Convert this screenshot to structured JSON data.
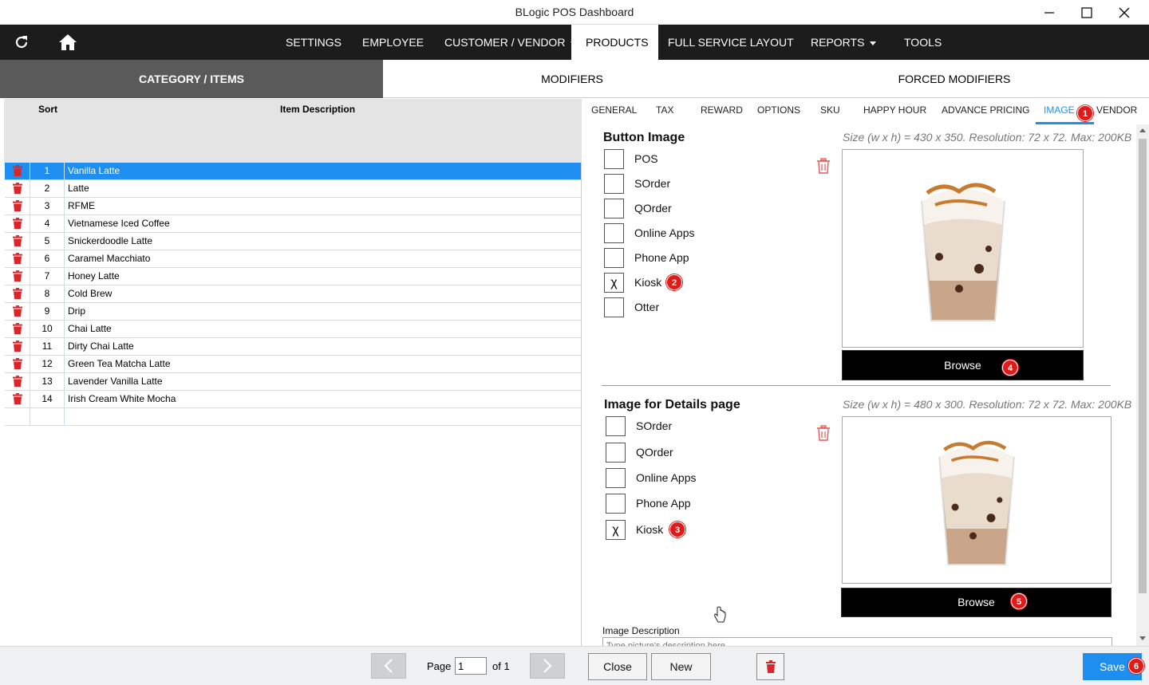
{
  "window": {
    "title": "BLogic POS Dashboard"
  },
  "nav": {
    "icons": [
      "refresh-icon",
      "home-icon"
    ],
    "items": [
      {
        "label": "SETTINGS"
      },
      {
        "label": "EMPLOYEE"
      },
      {
        "label": "CUSTOMER / VENDOR",
        "dropdown": true
      },
      {
        "label": "PRODUCTS",
        "active": true
      },
      {
        "label": "FULL SERVICE LAYOUT"
      },
      {
        "label": "REPORTS",
        "dropdown": true
      },
      {
        "label": "TOOLS"
      }
    ]
  },
  "section_tabs": [
    {
      "label": "CATEGORY / ITEMS",
      "active": true
    },
    {
      "label": "MODIFIERS"
    },
    {
      "label": "FORCED MODIFIERS"
    }
  ],
  "grid": {
    "columns": {
      "sort": "Sort",
      "description": "Item Description"
    },
    "rows": [
      {
        "sort": "1",
        "desc": "Vanilla Latte",
        "selected": true
      },
      {
        "sort": "2",
        "desc": "Latte"
      },
      {
        "sort": "3",
        "desc": "RFME"
      },
      {
        "sort": "4",
        "desc": "Vietnamese Iced Coffee"
      },
      {
        "sort": "5",
        "desc": "Snickerdoodle Latte"
      },
      {
        "sort": "6",
        "desc": "Caramel Macchiato"
      },
      {
        "sort": "7",
        "desc": "Honey Latte"
      },
      {
        "sort": "8",
        "desc": "Cold Brew"
      },
      {
        "sort": "9",
        "desc": "Drip"
      },
      {
        "sort": "10",
        "desc": "Chai Latte"
      },
      {
        "sort": "11",
        "desc": "Dirty Chai Latte"
      },
      {
        "sort": "12",
        "desc": "Green Tea Matcha Latte"
      },
      {
        "sort": "13",
        "desc": "Lavender Vanilla Latte"
      },
      {
        "sort": "14",
        "desc": "Irish Cream White Mocha"
      }
    ]
  },
  "sub_tabs": [
    {
      "label": "GENERAL"
    },
    {
      "label": "TAX"
    },
    {
      "label": "REWARD"
    },
    {
      "label": "OPTIONS"
    },
    {
      "label": "SKU"
    },
    {
      "label": "HAPPY HOUR"
    },
    {
      "label": "ADVANCE PRICING"
    },
    {
      "label": "IMAGE",
      "active": true,
      "badge": "1"
    },
    {
      "label": "VENDOR"
    }
  ],
  "button_image": {
    "heading": "Button Image",
    "size_info": "Size (w x h) = 430 x 350. Resolution: 72 x 72. Max: 200KB",
    "options": [
      {
        "label": "POS",
        "checked": ""
      },
      {
        "label": "SOrder",
        "checked": ""
      },
      {
        "label": "QOrder",
        "checked": ""
      },
      {
        "label": "Online Apps",
        "checked": ""
      },
      {
        "label": "Phone App",
        "checked": ""
      },
      {
        "label": "Kiosk",
        "checked": "χ",
        "badge": "2"
      },
      {
        "label": "Otter",
        "checked": ""
      }
    ],
    "browse_label": "Browse",
    "browse_badge": "4"
  },
  "details_image": {
    "heading": "Image for Details page",
    "size_info": "Size (w x h) = 480 x 300. Resolution: 72 x 72. Max: 200KB",
    "options": [
      {
        "label": "SOrder",
        "checked": ""
      },
      {
        "label": "QOrder",
        "checked": ""
      },
      {
        "label": "Online Apps",
        "checked": ""
      },
      {
        "label": "Phone App",
        "checked": ""
      },
      {
        "label": "Kiosk",
        "checked": "χ",
        "badge": "3"
      }
    ],
    "browse_label": "Browse",
    "browse_badge": "5"
  },
  "image_description": {
    "label": "Image Description",
    "placeholder": "Type picture's description here"
  },
  "pager": {
    "page_label": "Page",
    "page_value": "1",
    "of_label": "of 1"
  },
  "buttons": {
    "close": "Close",
    "new": "New",
    "save": "Save",
    "save_badge": "6"
  },
  "colors": {
    "accent": "#1f8ef1",
    "badge": "#e01919",
    "nav_bg": "#1c1c1c",
    "trash": "#d9262b"
  }
}
